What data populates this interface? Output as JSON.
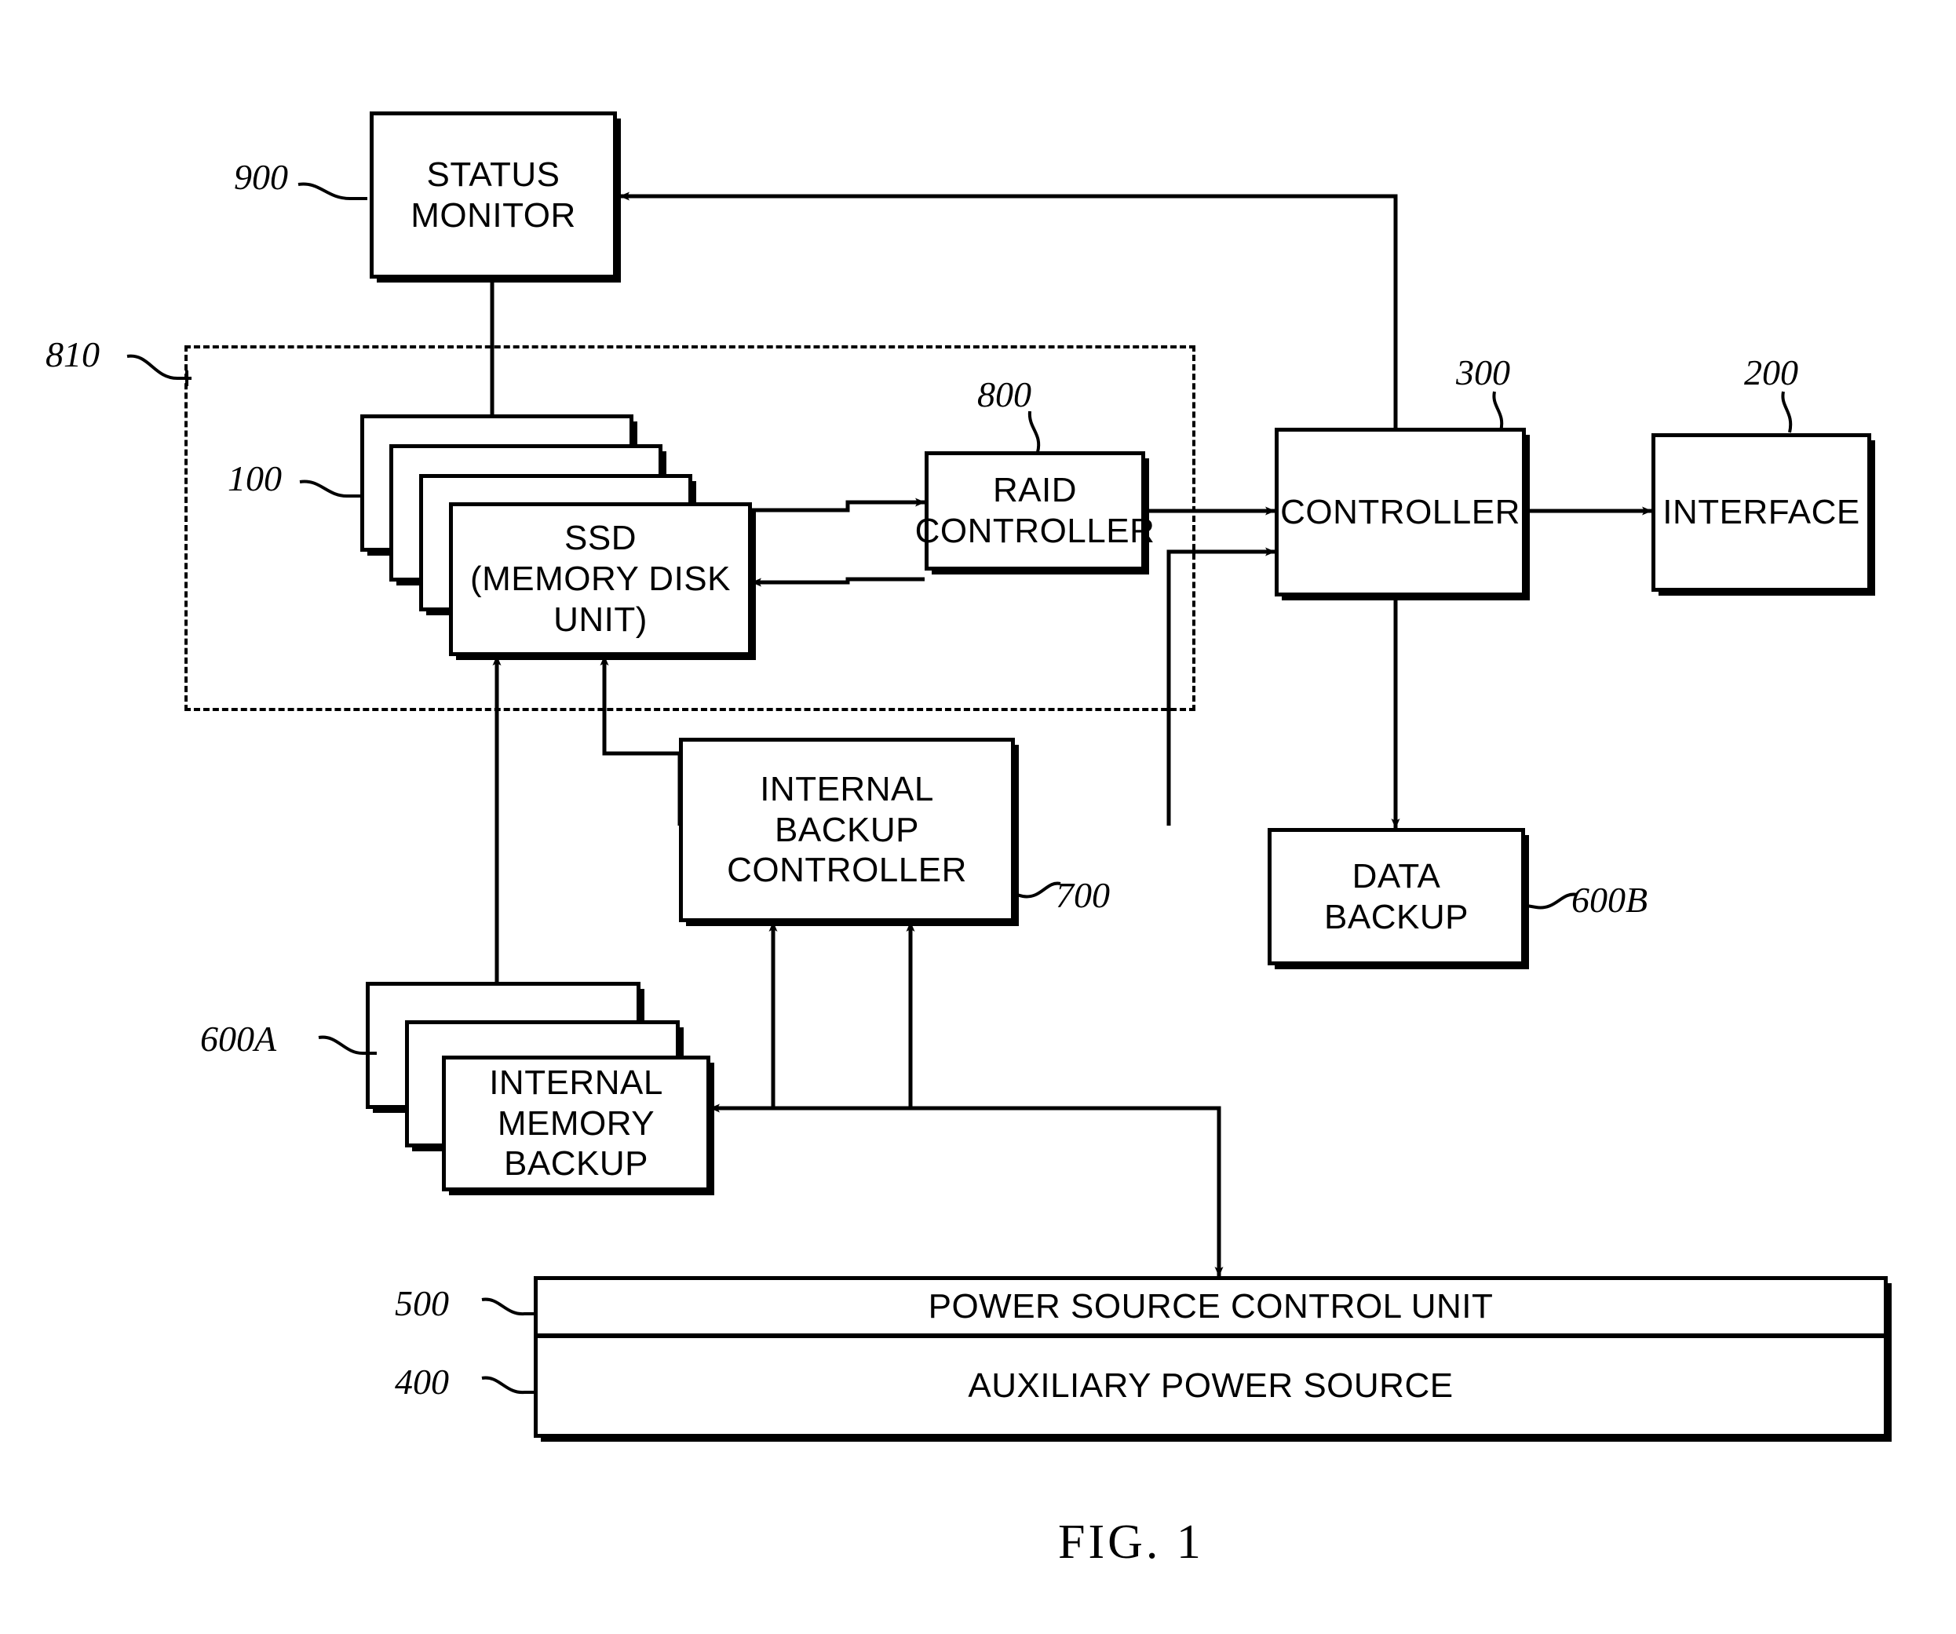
{
  "figure": {
    "caption": "FIG. 1",
    "type": "patent-block-diagram"
  },
  "nodes": {
    "status_monitor": {
      "label": "STATUS MONITOR",
      "ref": "900"
    },
    "ssd": {
      "label": "SSD\n(MEMORY DISK UNIT)",
      "ref": "100",
      "line1": "SSD",
      "line2": "(MEMORY DISK",
      "line3": "UNIT)"
    },
    "raid_controller": {
      "label": "RAID CONTROLLER",
      "ref": "800",
      "line1": "RAID",
      "line2": "CONTROLLER"
    },
    "controller": {
      "label": "CONTROLLER",
      "ref": "300"
    },
    "interface": {
      "label": "INTERFACE",
      "ref": "200"
    },
    "internal_backup_controller": {
      "label": "INTERNAL BACKUP CONTROLLER",
      "ref": "700",
      "line1": "INTERNAL BACKUP",
      "line2": "CONTROLLER"
    },
    "data_backup": {
      "label": "DATA BACKUP",
      "ref": "600B"
    },
    "internal_memory_backup": {
      "label": "INTERNAL MEMORY BACKUP",
      "ref": "600A",
      "line1": "INTERNAL MEMORY",
      "line2": "BACKUP"
    },
    "power_source_control_unit": {
      "label": "POWER SOURCE CONTROL UNIT",
      "ref": "500"
    },
    "auxiliary_power_source": {
      "label": "AUXILIARY POWER SOURCE",
      "ref": "400"
    },
    "enclosure": {
      "label": "",
      "ref": "810"
    }
  },
  "reference_numerals": [
    "900",
    "810",
    "100",
    "800",
    "300",
    "200",
    "700",
    "600B",
    "600A",
    "500",
    "400"
  ],
  "colors": {
    "stroke": "#000000",
    "fill": "#ffffff",
    "background": "#ffffff"
  }
}
